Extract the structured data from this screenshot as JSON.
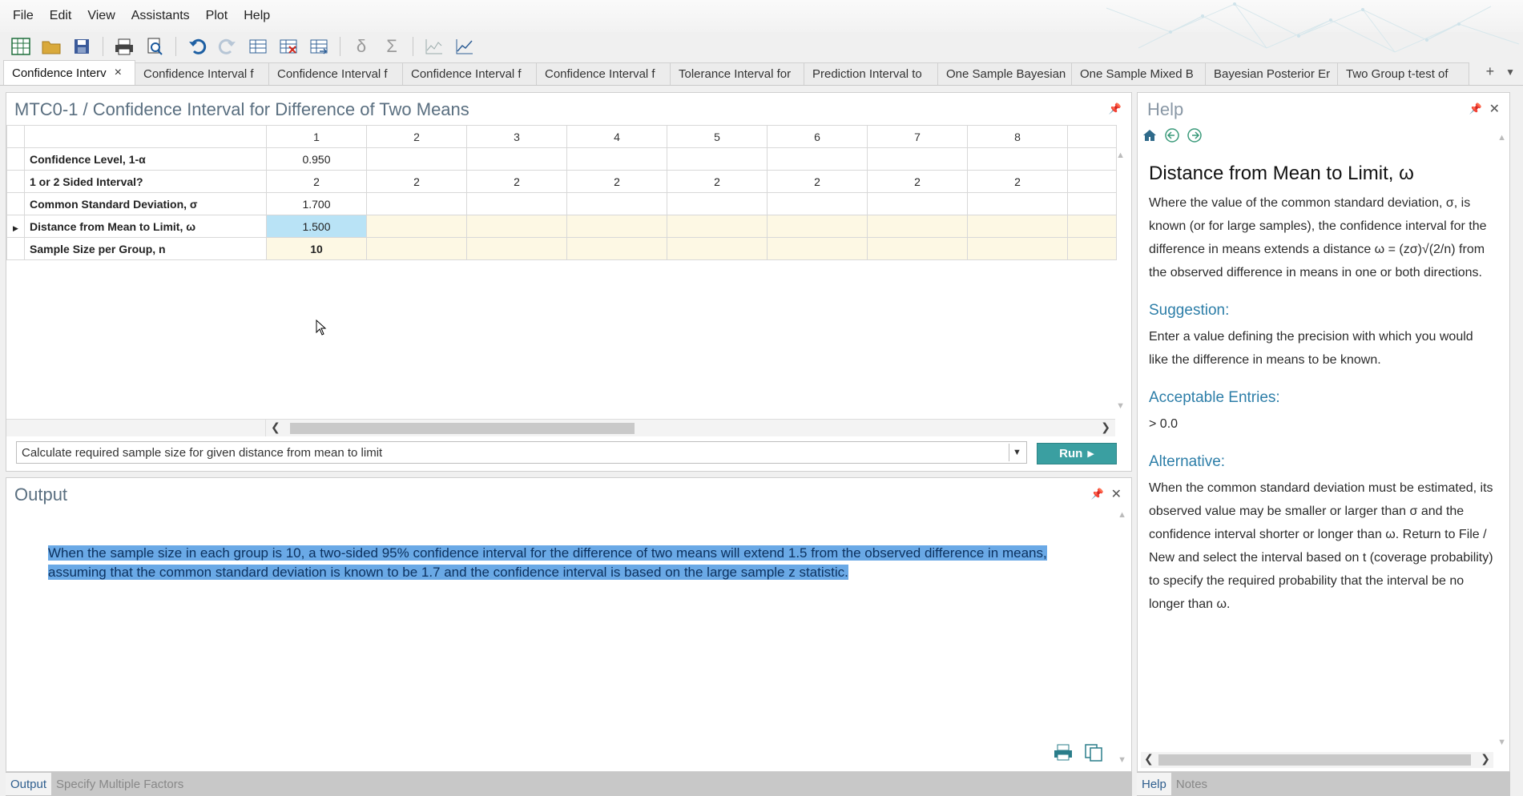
{
  "menu": [
    "File",
    "Edit",
    "View",
    "Assistants",
    "Plot",
    "Help"
  ],
  "tabs": [
    {
      "label": "Confidence Interv",
      "active": true
    },
    {
      "label": "Confidence Interval f"
    },
    {
      "label": "Confidence Interval f"
    },
    {
      "label": "Confidence Interval f"
    },
    {
      "label": "Confidence Interval f"
    },
    {
      "label": "Tolerance Interval for"
    },
    {
      "label": "Prediction Interval to"
    },
    {
      "label": "One Sample Bayesian"
    },
    {
      "label": "One Sample Mixed B"
    },
    {
      "label": "Bayesian Posterior Er"
    },
    {
      "label": "Two Group t-test of"
    }
  ],
  "grid_panel": {
    "title": "MTC0-1 / Confidence Interval for Difference of Two Means",
    "columns": [
      "1",
      "2",
      "3",
      "4",
      "5",
      "6",
      "7",
      "8",
      ""
    ],
    "rows": [
      {
        "label": "Confidence Level, 1-α",
        "values": [
          "0.950",
          "",
          "",
          "",
          "",
          "",
          "",
          "",
          ""
        ]
      },
      {
        "label": "1 or 2 Sided Interval?",
        "values": [
          "2",
          "2",
          "2",
          "2",
          "2",
          "2",
          "2",
          "2",
          ""
        ]
      },
      {
        "label": "Common Standard Deviation, σ",
        "values": [
          "1.700",
          "",
          "",
          "",
          "",
          "",
          "",
          "",
          ""
        ]
      },
      {
        "label": "Distance from Mean to Limit, ω",
        "values": [
          "1.500",
          "",
          "",
          "",
          "",
          "",
          "",
          "",
          ""
        ]
      },
      {
        "label": "Sample Size per Group, n",
        "values": [
          "10",
          "",
          "",
          "",
          "",
          "",
          "",
          "",
          ""
        ]
      }
    ],
    "command": "Calculate required sample size for given distance from mean to limit",
    "run_label": "Run"
  },
  "output_panel": {
    "title": "Output",
    "text": "When the sample size in each group is 10, a two-sided 95% confidence interval for the difference of two means will extend 1.5 from the observed difference in means, assuming that the common standard deviation is known to be 1.7 and the confidence interval is based on the large sample z statistic.",
    "tabs": [
      "Output",
      "Specify Multiple Factors"
    ]
  },
  "help_panel": {
    "title": "Help",
    "heading": "Distance from Mean to Limit, ω",
    "intro": "Where the value of the common standard deviation, σ, is known (or for large samples), the confidence interval for the difference in means extends a distance ω = (zσ)√(2/n) from the observed difference in means in one or both directions.",
    "suggestion_title": "Suggestion:",
    "suggestion": "Enter a value defining the precision with which you would like the difference in means to be known.",
    "acceptable_title": "Acceptable Entries:",
    "acceptable": "> 0.0",
    "alternative_title": "Alternative:",
    "alternative": "When the common standard deviation must be estimated, its observed value may be smaller or larger than σ and the confidence interval shorter or longer than ω. Return to File / New and select the interval based on t (coverage probability) to specify the required probability that the interval be no longer than ω.",
    "tabs": [
      "Help",
      "Notes"
    ]
  }
}
